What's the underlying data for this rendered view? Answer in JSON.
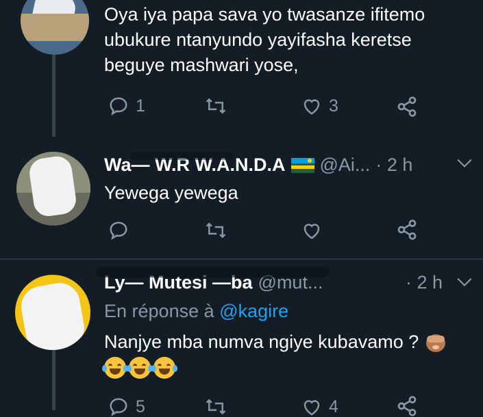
{
  "tweets": [
    {
      "text": "Oya iya papa sava yo twasanze ifitemo ubukure ntanyundo yayifasha keretse beguye mashwari yose,",
      "replies": "1",
      "retweets": "",
      "likes": "3"
    },
    {
      "name": "Wa— W.R W.A.N.D.A",
      "handle": "@Ai...",
      "time": "· 2 h",
      "text": "Yewega yewega",
      "replies": "",
      "retweets": "",
      "likes": ""
    },
    {
      "name": "Ly— Mutesi —ba",
      "handle": "@mut...",
      "time": "· 2 h",
      "reply_prefix": "En réponse à",
      "reply_to": "@kagire",
      "text": "Nanjye mba numva ngiye kubavamo ?",
      "emoji": "😂😂😂",
      "replies": "5",
      "retweets": "",
      "likes": "4"
    }
  ],
  "colors": {
    "background": "#141d26",
    "muted": "#8899a6",
    "link": "#1da1f2",
    "text": "#ffffff"
  }
}
